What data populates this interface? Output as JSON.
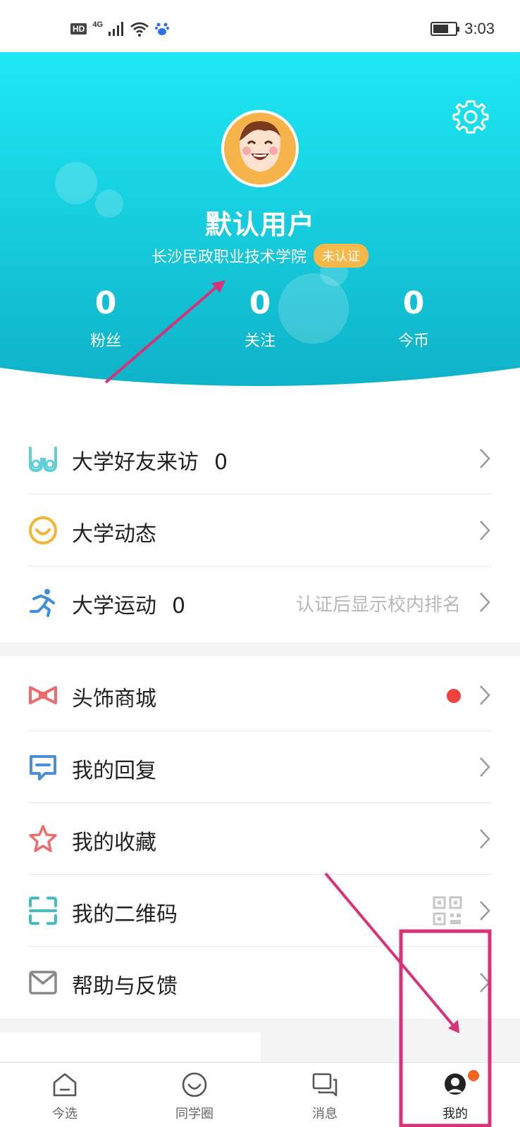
{
  "status_bar": {
    "hd": "HD",
    "network": "4G",
    "time": "3:03"
  },
  "profile": {
    "username": "默认用户",
    "school": "长沙民政职业技术学院",
    "verify_badge": "未认证",
    "stats": [
      {
        "value": "0",
        "label": "粉丝"
      },
      {
        "value": "0",
        "label": "关注"
      },
      {
        "value": "0",
        "label": "今币"
      }
    ]
  },
  "menu": {
    "friends_visit": {
      "label": "大学好友来访",
      "count": "0"
    },
    "dynamics": {
      "label": "大学动态"
    },
    "sports": {
      "label": "大学运动",
      "count": "0",
      "hint": "认证后显示校内排名"
    },
    "headwear_mall": {
      "label": "头饰商城"
    },
    "my_replies": {
      "label": "我的回复"
    },
    "my_favorites": {
      "label": "我的收藏"
    },
    "my_qrcode": {
      "label": "我的二维码"
    },
    "help_feedback": {
      "label": "帮助与反馈"
    }
  },
  "tabbar": {
    "tabs": [
      {
        "label": "今选",
        "icon": "home-icon"
      },
      {
        "label": "同学圈",
        "icon": "smile-circle-icon"
      },
      {
        "label": "消息",
        "icon": "chat-bubbles-icon"
      },
      {
        "label": "我的",
        "icon": "profile-icon"
      }
    ]
  },
  "colors": {
    "header_top": "#1ee6f2",
    "header_bottom": "#0fb8cc",
    "badge": "#f7b84a",
    "annotation": "#d6337a",
    "red_dot": "#f0413c"
  }
}
